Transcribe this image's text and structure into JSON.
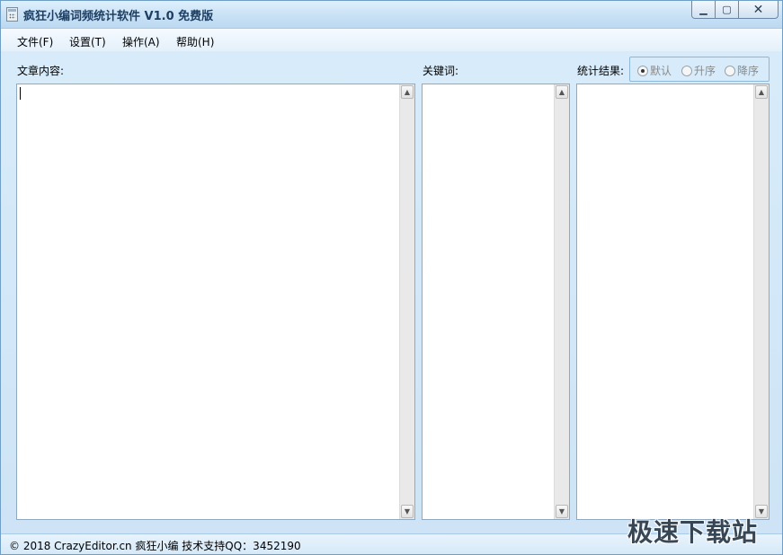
{
  "window": {
    "title": "疯狂小编词频统计软件 V1.0 免费版",
    "controls": {
      "minimize": "▁",
      "maximize": "▢",
      "close": "✕"
    }
  },
  "menu": [
    {
      "label": "文件(F)"
    },
    {
      "label": "设置(T)"
    },
    {
      "label": "操作(A)"
    },
    {
      "label": "帮助(H)"
    }
  ],
  "panels": {
    "article": {
      "label": "文章内容:",
      "value": ""
    },
    "keywords": {
      "label": "关键词:",
      "value": ""
    },
    "results": {
      "label": "统计结果:",
      "value": ""
    }
  },
  "sort_options": [
    {
      "label": "默认",
      "selected": true
    },
    {
      "label": "升序",
      "selected": false
    },
    {
      "label": "降序",
      "selected": false
    }
  ],
  "scroll": {
    "up": "▲",
    "down": "▼"
  },
  "status": {
    "text": "© 2018 CrazyEditor.cn 疯狂小编    技术支持QQ：3452190"
  },
  "watermark": {
    "text": "极速下载站"
  }
}
